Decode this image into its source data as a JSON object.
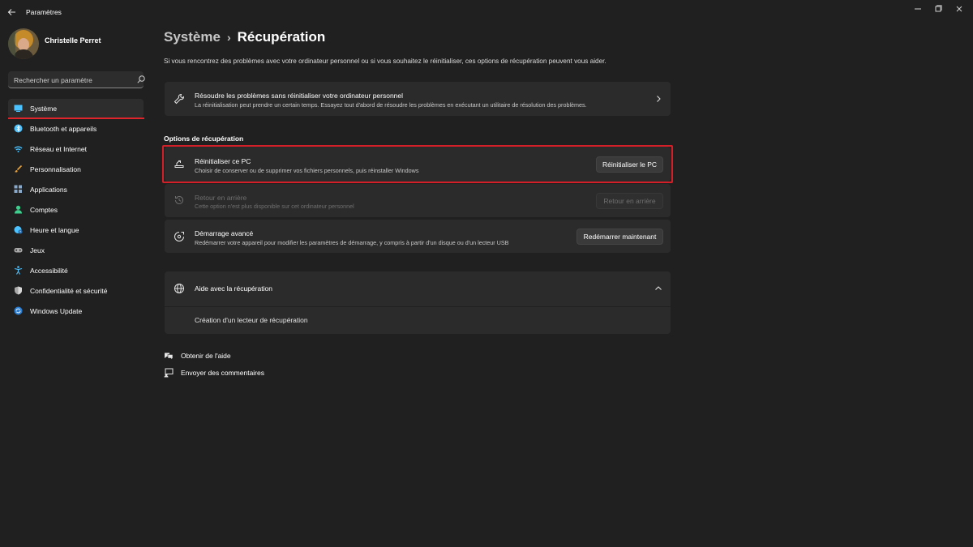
{
  "window": {
    "title": "Paramètres",
    "back_icon": "back-arrow-icon",
    "controls": [
      "minimize-icon",
      "maximize-icon",
      "close-icon"
    ]
  },
  "profile": {
    "name": "Christelle Perret"
  },
  "search": {
    "placeholder": "Rechercher un paramètre",
    "icon": "search-icon"
  },
  "sidebar": {
    "items": [
      {
        "label": "Système",
        "icon": "monitor-icon",
        "active": true,
        "color": "#4cc2ff"
      },
      {
        "label": "Bluetooth et appareils",
        "icon": "bluetooth-icon",
        "color": "#4cc2ff"
      },
      {
        "label": "Réseau et Internet",
        "icon": "wifi-icon",
        "color": "#4cc2ff"
      },
      {
        "label": "Personnalisation",
        "icon": "brush-icon",
        "color": "#e8a23a"
      },
      {
        "label": "Applications",
        "icon": "apps-icon",
        "color": "#8aa9c9"
      },
      {
        "label": "Comptes",
        "icon": "account-icon",
        "color": "#3ecf8e"
      },
      {
        "label": "Heure et langue",
        "icon": "globe-clock-icon",
        "color": "#4cc2ff"
      },
      {
        "label": "Jeux",
        "icon": "gamepad-icon",
        "color": "#a8a8a8"
      },
      {
        "label": "Accessibilité",
        "icon": "accessibility-icon",
        "color": "#4cc2ff"
      },
      {
        "label": "Confidentialité et sécurité",
        "icon": "shield-icon",
        "color": "#a8a8a8"
      },
      {
        "label": "Windows Update",
        "icon": "update-icon",
        "color": "#4cc2ff"
      }
    ]
  },
  "main": {
    "breadcrumb": {
      "parent": "Système",
      "separator": "›",
      "current": "Récupération"
    },
    "intro": "Si vous rencontrez des problèmes avec votre ordinateur personnel ou si vous souhaitez le réinitialiser, ces options de récupération peuvent vous aider.",
    "troubleshoot": {
      "title": "Résoudre les problèmes sans réinitialiser votre ordinateur personnel",
      "desc": "La réinitialisation peut prendre un certain temps. Essayez tout d'abord de résoudre les problèmes en exécutant un utilitaire de résolution des problèmes.",
      "icon": "wrench-icon"
    },
    "section_label": "Options de récupération",
    "options": {
      "reset": {
        "title": "Réinitialiser ce PC",
        "desc": "Choisir de conserver ou de supprimer vos fichiers personnels, puis réinstaller Windows",
        "button": "Réinitialiser le PC",
        "icon": "reset-pc-icon"
      },
      "goback": {
        "title": "Retour en arrière",
        "desc": "Cette option n'est plus disponible sur cet ordinateur personnel",
        "button": "Retour en arrière",
        "icon": "history-icon"
      },
      "advanced": {
        "title": "Démarrage avancé",
        "desc": "Redémarrer votre appareil pour modifier les paramètres de démarrage, y compris à partir d'un disque ou d'un lecteur USB",
        "button": "Redémarrer maintenant",
        "icon": "advanced-startup-icon"
      }
    },
    "help": {
      "title": "Aide avec la récupération",
      "icon": "globe-icon",
      "link": "Création d'un lecteur de récupération"
    },
    "footer_links": [
      {
        "label": "Obtenir de l'aide",
        "icon": "help-chat-icon"
      },
      {
        "label": "Envoyer des commentaires",
        "icon": "feedback-icon"
      }
    ]
  },
  "colors": {
    "background": "#202020",
    "card": "#2b2b2b",
    "accent": "#4cc2ff",
    "highlight_box": "#d32028"
  }
}
